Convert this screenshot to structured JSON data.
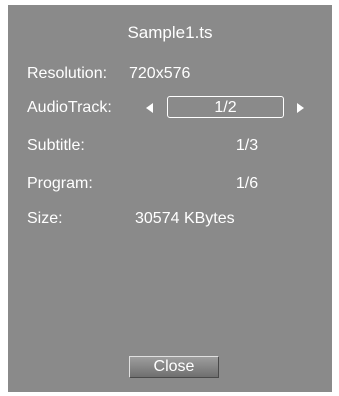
{
  "dialog": {
    "title": "Sample1.ts",
    "colors": {
      "panel_background": "#8a8a8a",
      "text": "#ffffff"
    },
    "rows": {
      "resolution": {
        "label": "Resolution:",
        "value": "720x576"
      },
      "audio_track": {
        "label": "AudioTrack:",
        "value": "1/2",
        "left_icon": "arrow-left-icon",
        "right_icon": "arrow-right-icon"
      },
      "subtitle": {
        "label": "Subtitle:",
        "value": "1/3"
      },
      "program": {
        "label": "Program:",
        "value": "1/6"
      },
      "size": {
        "label": "Size:",
        "value": "30574 KBytes"
      }
    },
    "close_button": {
      "label": "Close"
    }
  }
}
